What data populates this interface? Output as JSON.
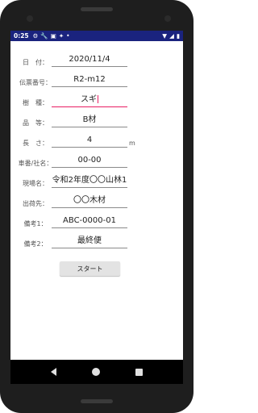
{
  "status": {
    "time": "0:25",
    "icons_left": [
      "gear-icon",
      "wrench-icon",
      "image-icon",
      "star-icon",
      "dot-icon"
    ],
    "icons_right": [
      "wifi-icon",
      "signal-icon",
      "battery-icon"
    ]
  },
  "form": {
    "date_label": "日　付：",
    "date_value": "2020/11/4",
    "slip_label": "伝票番号：",
    "slip_value": "R2-m12",
    "species_label": "樹　種：",
    "species_value": "スギ",
    "grade_label": "品　等：",
    "grade_value": "B材",
    "length_label": "長　さ：",
    "length_value": "4",
    "length_unit": "m",
    "vehicle_label": "車番/社名：",
    "vehicle_value": "00-00",
    "site_label": "現場名：",
    "site_value": "令和2年度〇〇山林1",
    "destination_label": "出荷先：",
    "destination_value": "〇〇木材",
    "note1_label": "備考1：",
    "note1_value": "ABC-0000-01",
    "note2_label": "備考2：",
    "note2_value": "最終便"
  },
  "actions": {
    "start_label": "スタート"
  }
}
